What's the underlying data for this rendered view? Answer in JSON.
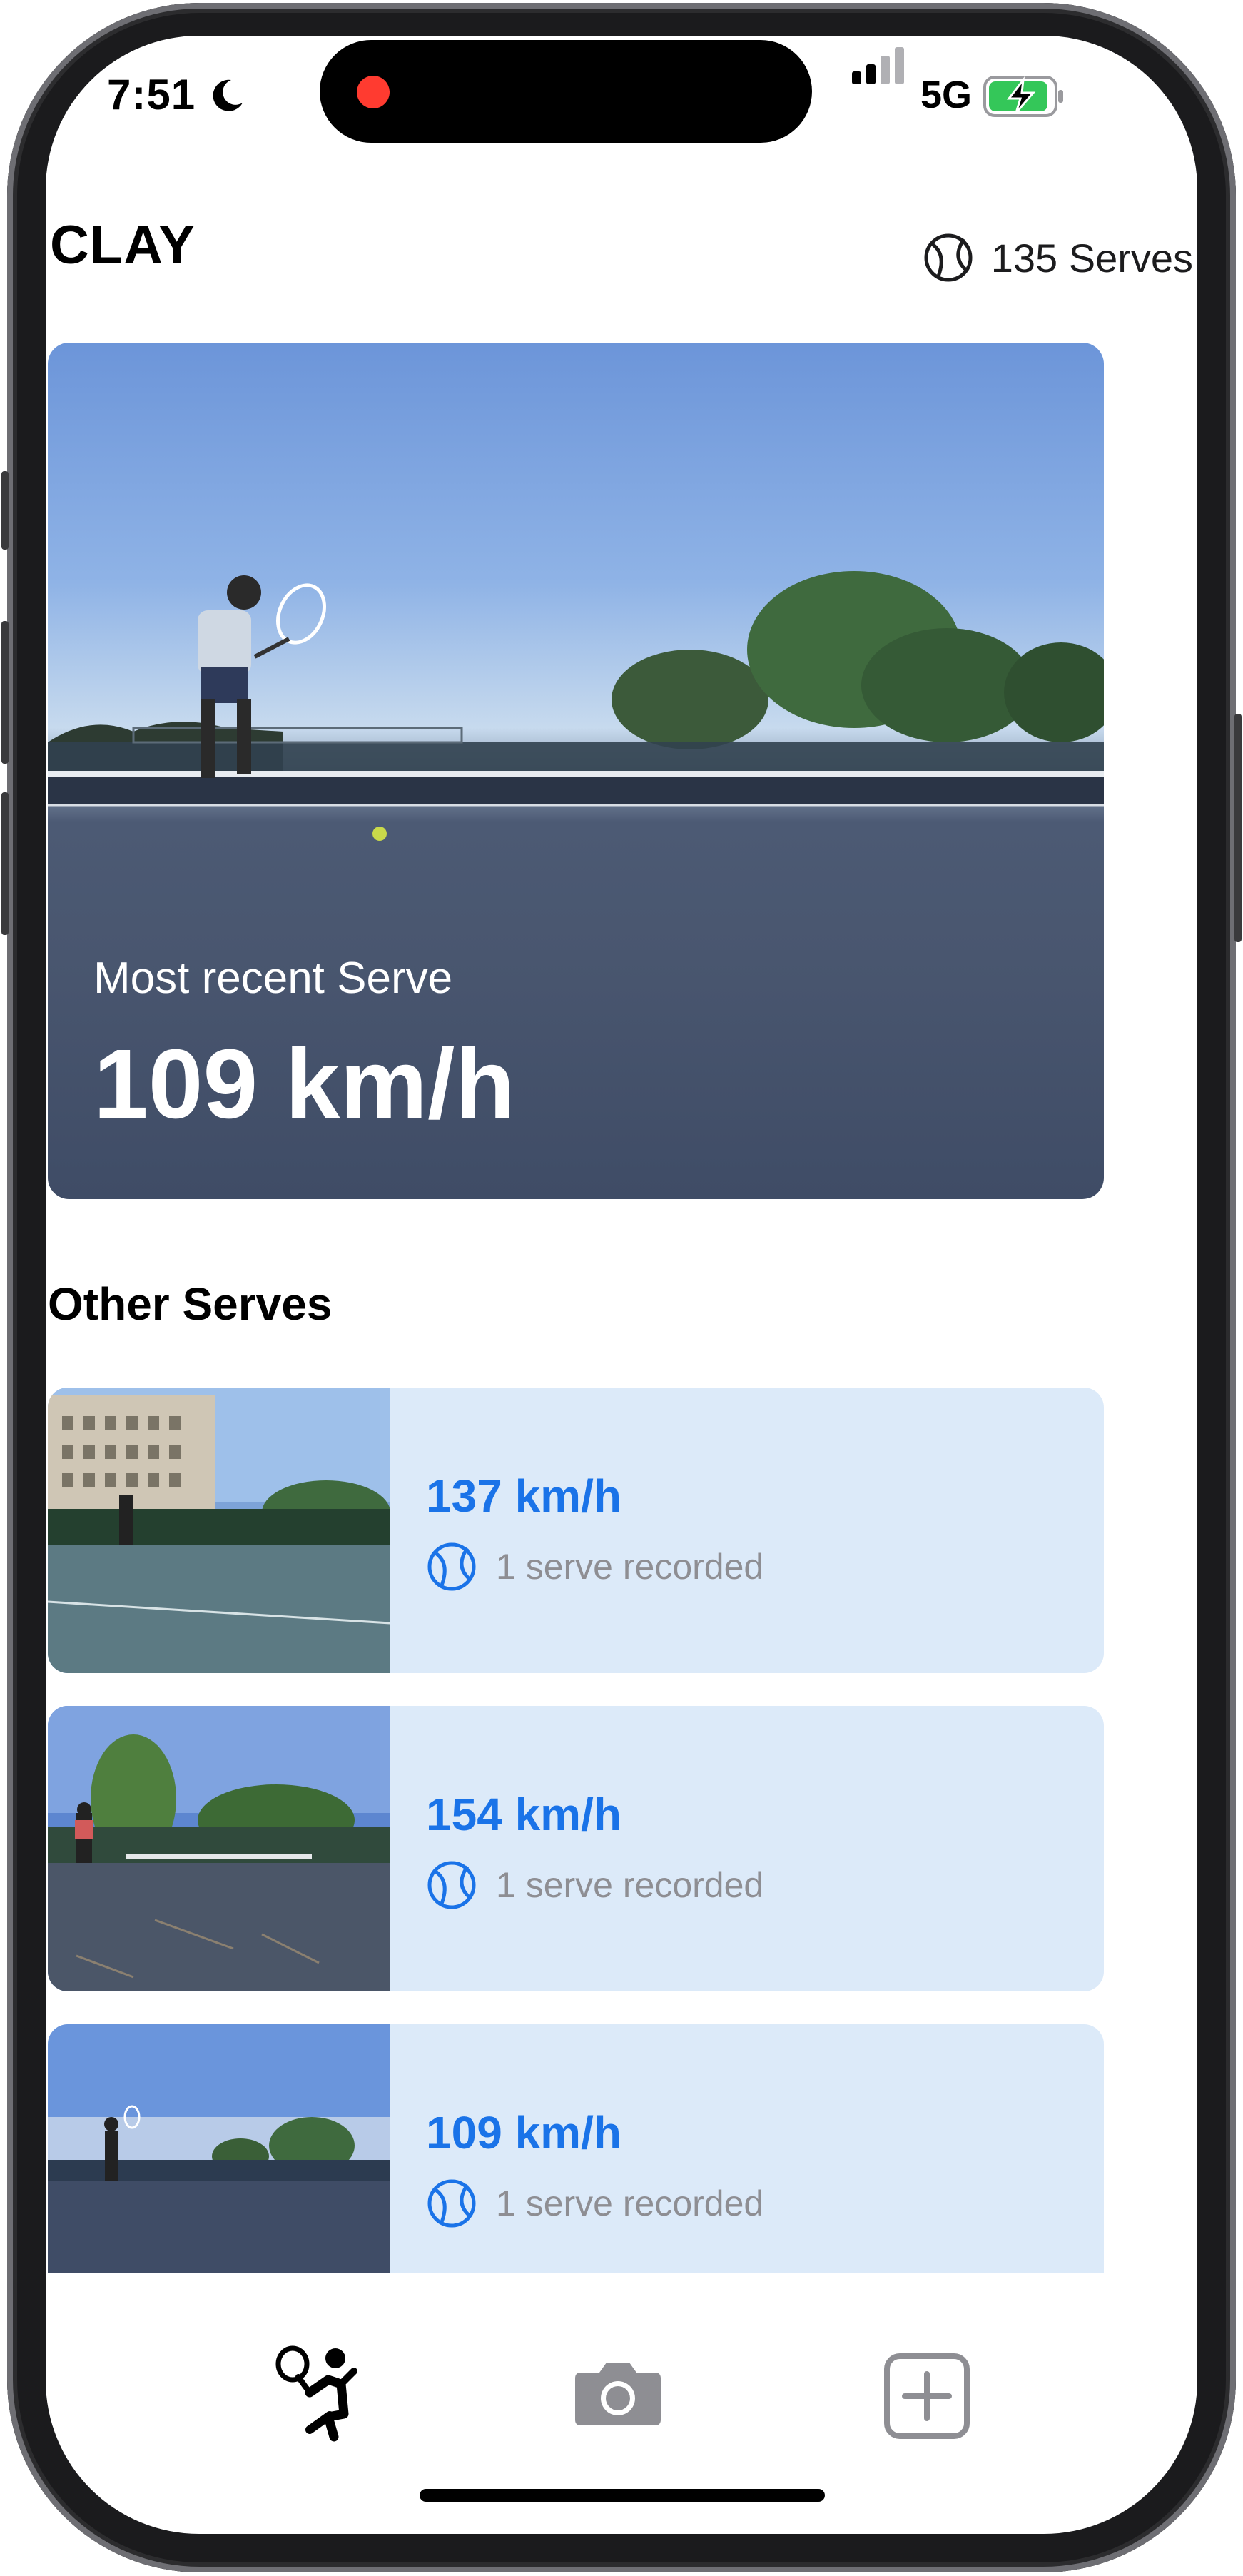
{
  "status_bar": {
    "time": "7:51",
    "network": "5G",
    "icons": [
      "moon-icon",
      "signal-icon",
      "battery-charging-icon"
    ]
  },
  "header": {
    "title": "CLAY",
    "serve_count": "135 Serves",
    "icon": "tennis-ball-icon"
  },
  "hero": {
    "label": "Most recent Serve",
    "speed": "109 km/h"
  },
  "section": {
    "title": "Other Serves"
  },
  "serves": [
    {
      "speed": "137 km/h",
      "meta": "1 serve recorded"
    },
    {
      "speed": "154 km/h",
      "meta": "1 serve recorded"
    },
    {
      "speed": "109 km/h",
      "meta": "1 serve recorded"
    }
  ],
  "tab_bar": {
    "icons": [
      "tennis-player-icon",
      "camera-icon",
      "add-square-icon"
    ]
  },
  "colors": {
    "accent": "#1a73e8",
    "card_bg": "#dceaf9",
    "meta": "#8e8e93",
    "record": "#ff3b30"
  }
}
